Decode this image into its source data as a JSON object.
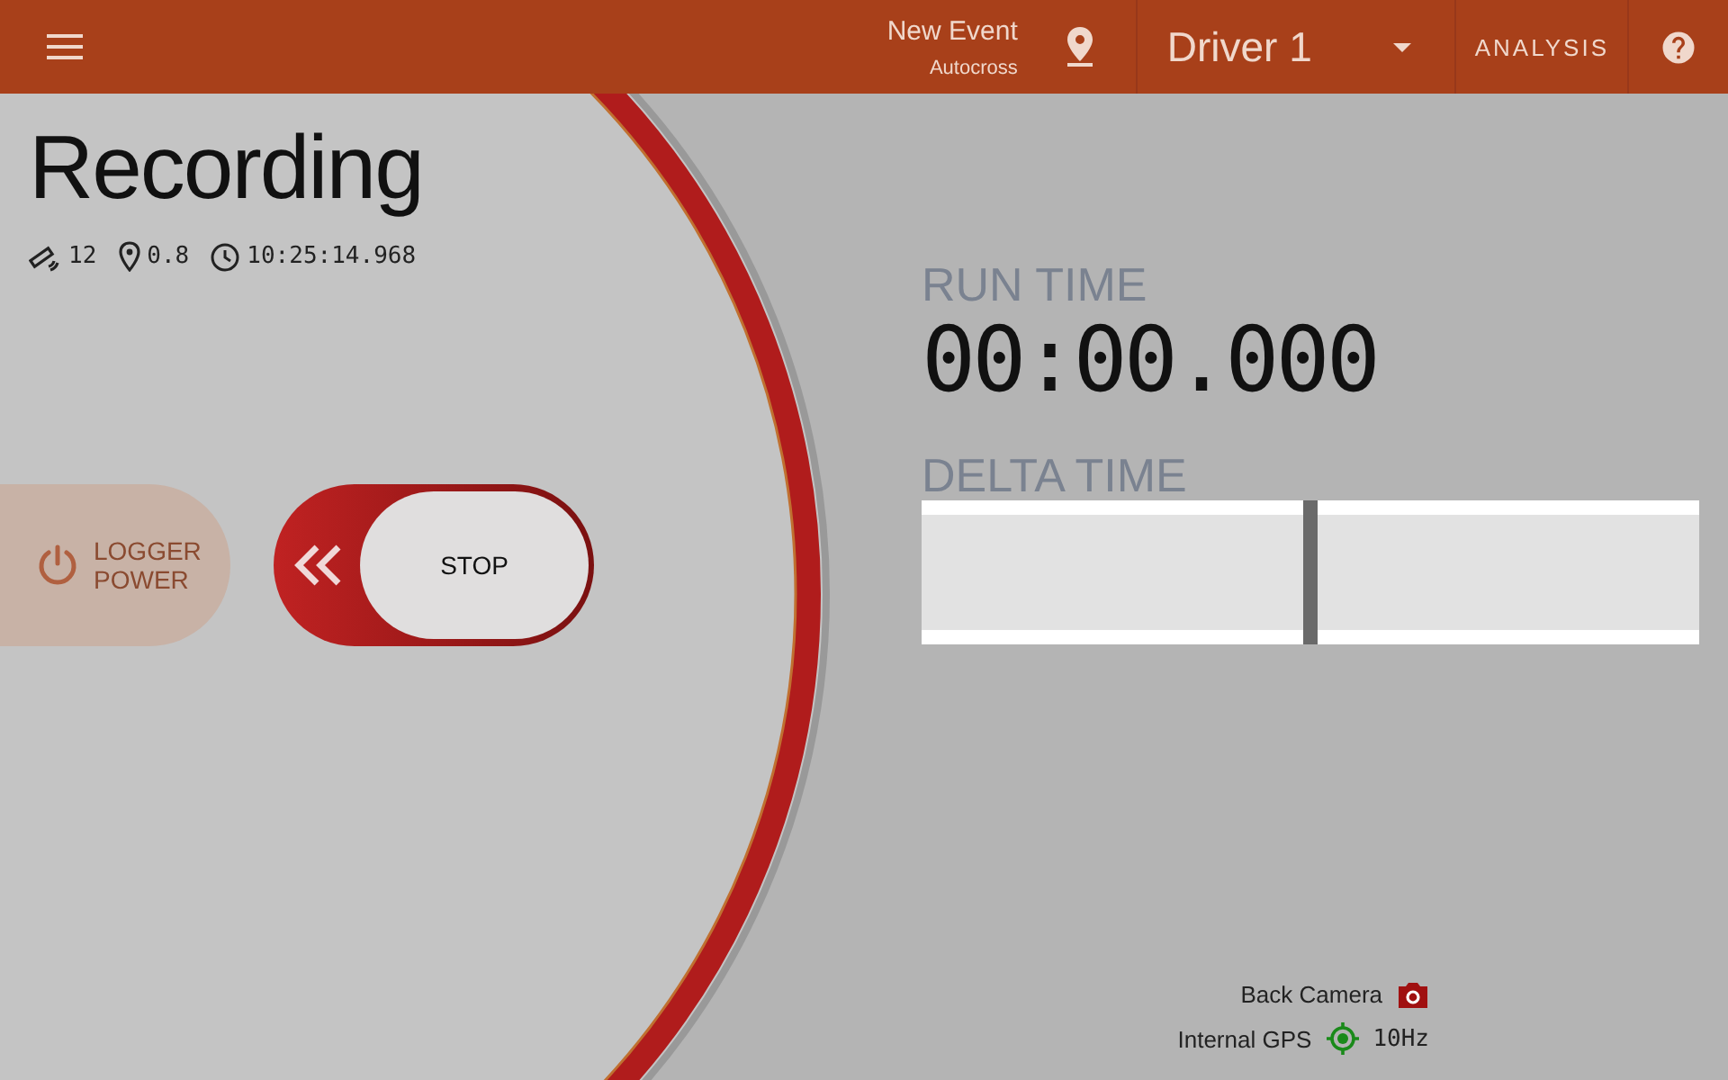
{
  "app_bar": {
    "event_name": "New Event",
    "event_type": "Autocross",
    "driver": "Driver 1",
    "analysis_label": "ANALYSIS"
  },
  "status": {
    "title": "Recording",
    "satellites": "12",
    "accuracy": "0.8",
    "clock": "10:25:14.968"
  },
  "controls": {
    "logger_power": {
      "label": "LOGGER POWER",
      "disabled": true
    },
    "stop": {
      "label": "STOP"
    }
  },
  "run_time": {
    "label": "RUN TIME",
    "value": "00:00.000"
  },
  "delta_time": {
    "label": "DELTA TIME",
    "level": 0.5
  },
  "devices": [
    {
      "kind": "camera",
      "name": "Back Camera"
    },
    {
      "kind": "gps",
      "name": "Internal GPS",
      "rate": "10Hz"
    }
  ]
}
